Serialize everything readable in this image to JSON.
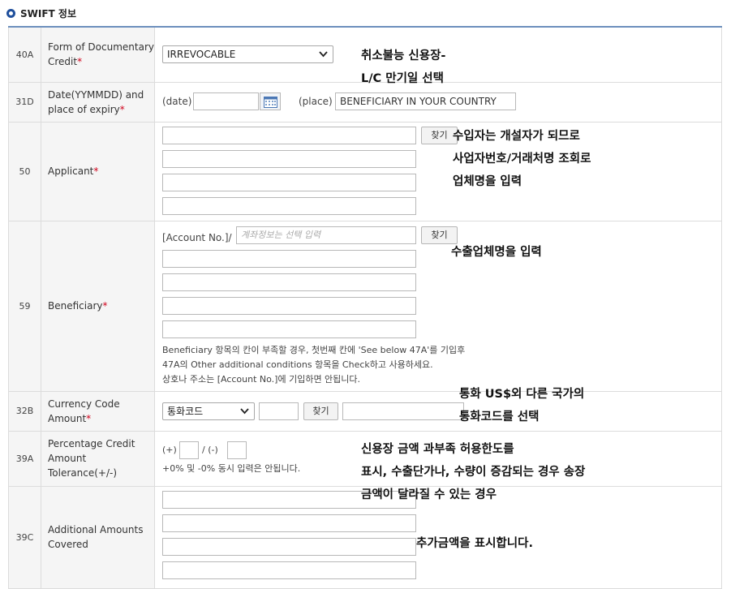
{
  "section": {
    "title": "SWIFT 정보"
  },
  "rows": {
    "r40a": {
      "tag": "40A",
      "label": "Form of Documentary Credit",
      "select_value": "IRREVOCABLE"
    },
    "r31d": {
      "tag": "31D",
      "label": "Date(YYMMDD) and place of expiry",
      "date_label": "(date)",
      "date_value": "",
      "place_label": "(place)",
      "place_value": "BENEFICIARY IN YOUR COUNTRY"
    },
    "r50": {
      "tag": "50",
      "label": "Applicant",
      "search_label": "찾기"
    },
    "r59": {
      "tag": "59",
      "label": "Beneficiary",
      "account_label": "[Account No.]/",
      "account_placeholder": "계좌정보는 선택 입력",
      "search_label": "찾기",
      "note_line1": "Beneficiary 항목의 칸이 부족할 경우, 첫번째 칸에 'See below 47A'를 기입후",
      "note_line2": "47A의 Other additional conditions 항목을 Check하고 사용하세요.",
      "note_line3": "상호나 주소는 [Account No.]에 기입하면 안됩니다."
    },
    "r32b": {
      "tag": "32B",
      "label": "Currency Code Amount",
      "select_value": "통화코드",
      "search_label": "찾기"
    },
    "r39a": {
      "tag": "39A",
      "label": "Percentage Credit Amount Tolerance(+/-)",
      "plus_label": "(+)",
      "minus_label": "/ (-)",
      "note": "+0% 및 -0% 동시 입력은 안됩니다."
    },
    "r39c": {
      "tag": "39C",
      "label": "Additional Amounts Covered"
    }
  },
  "annotations": {
    "a40a_line1": "취소불능 신용장-",
    "a40a_line2": "L/C 만기일 선택",
    "a50_line1": "수입자는 개설자가 되므로",
    "a50_line2": "사업자번호/거래처명 조회로",
    "a50_line3": "업체명을 입력",
    "a59": "수출업체명을 입력",
    "a32b_line1": "통화 US$외 다른 국가의",
    "a32b_line2": "통화코드를 선택",
    "a39a_line1": "신용장 금액 과부족 허용한도를",
    "a39a_line2": "표시, 수출단가나, 수량이 증감되는 경우 송장",
    "a39a_line3": "금액이 달라질 수 있는 경우",
    "a39c": "추가금액을 표시합니다."
  },
  "icons": {
    "section_bullet": "circle-bullet-icon",
    "calendar": "calendar-icon",
    "dropdown": "chevron-down-icon"
  },
  "colors": {
    "header_rule": "#6c8fbd",
    "label_bg": "#f5f5f5",
    "required": "#d0021b",
    "bullet": "#1f4f9c"
  }
}
